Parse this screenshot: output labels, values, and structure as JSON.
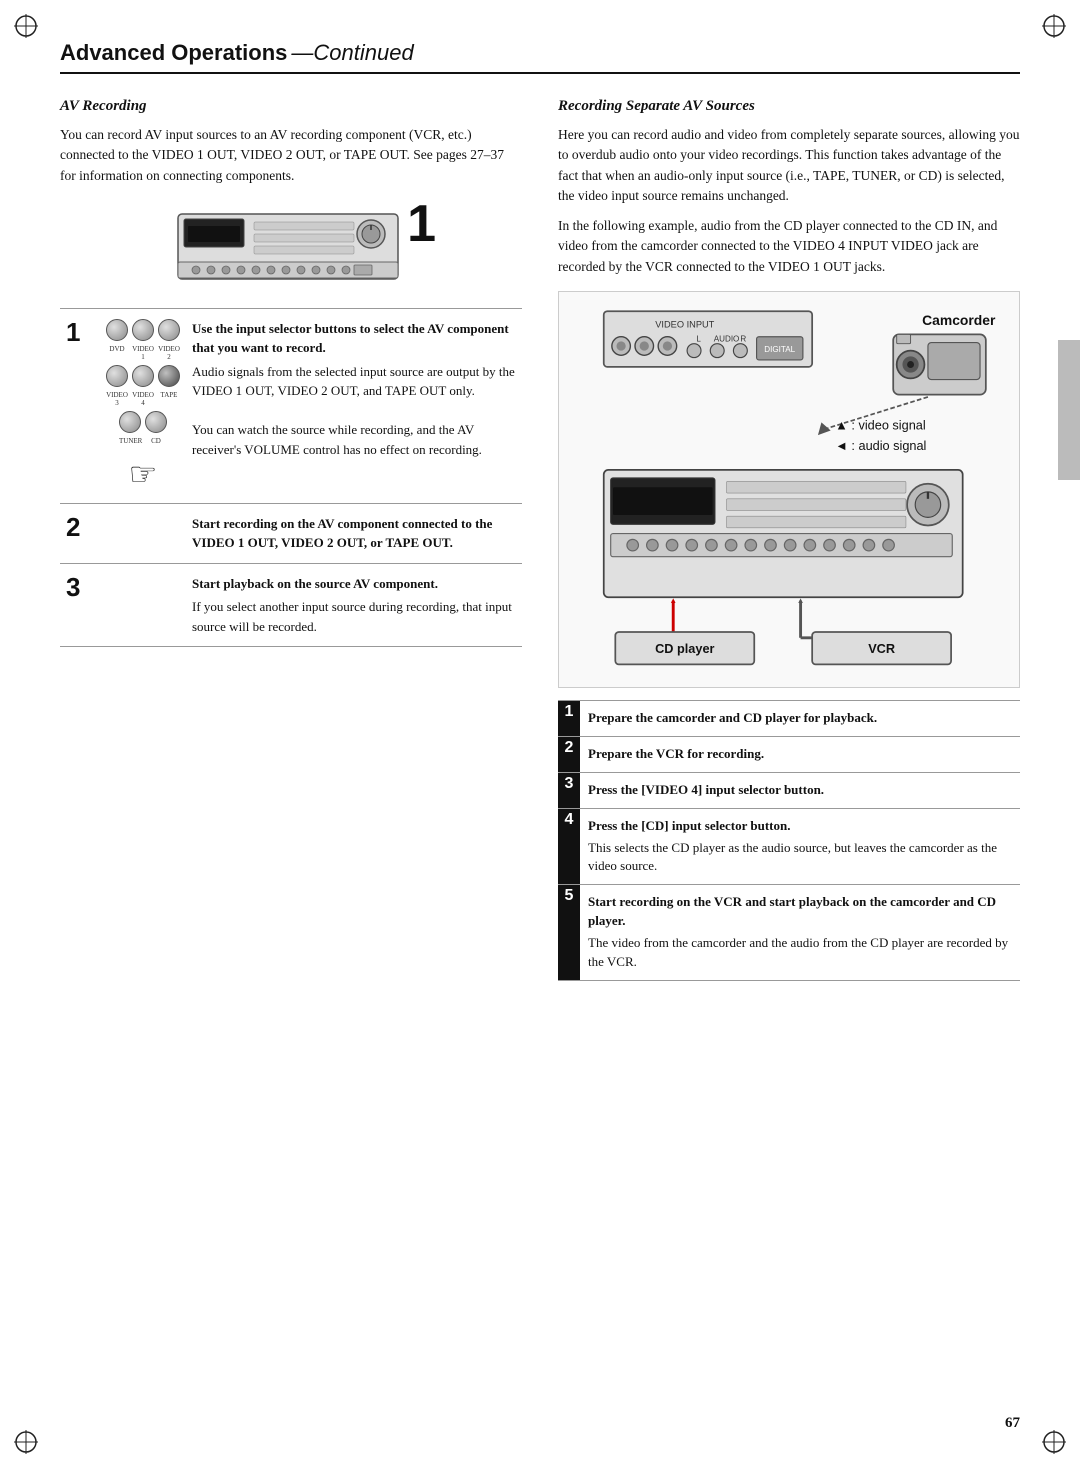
{
  "page": {
    "number": "67",
    "header": {
      "title": "Advanced Operations",
      "continued": "—Continued"
    },
    "gray_sidebar": true
  },
  "left_column": {
    "section_title": "AV Recording",
    "intro_text": "You can record AV input sources to an AV recording component (VCR, etc.) connected to the VIDEO 1 OUT, VIDEO 2 OUT, or TAPE OUT. See pages 27–37 for information on connecting components.",
    "steps": [
      {
        "num": "1",
        "title": "Use the input selector buttons to select the AV component that you want to record.",
        "body": "Audio signals from the selected input source are output by the VIDEO 1 OUT, VIDEO 2 OUT, and TAPE OUT only.\nYou can watch the source while recording, and the AV receiver's VOLUME control has no effect on recording.",
        "has_icon": true
      },
      {
        "num": "2",
        "title": "Start recording on the AV component connected to the VIDEO 1 OUT, VIDEO 2 OUT, or TAPE OUT.",
        "body": "",
        "has_icon": false
      },
      {
        "num": "3",
        "title": "Start playback on the source AV component.",
        "body": "If you select another input source during recording, that input source will be recorded.",
        "has_icon": false
      }
    ]
  },
  "right_column": {
    "section_title": "Recording Separate AV Sources",
    "intro_text1": "Here you can record audio and video from completely separate sources, allowing you to overdub audio onto your video recordings. This function takes advantage of the fact that when an audio-only input source (i.e., TAPE, TUNER, or CD) is selected, the video input source remains unchanged.",
    "intro_text2": "In the following example, audio from the CD player connected to the CD IN, and video from the camcorder connected to the VIDEO 4 INPUT VIDEO jack are recorded by the VCR connected to the VIDEO 1 OUT jacks.",
    "diagram": {
      "camcorder_label": "Camcorder",
      "video_signal_label": ": video signal",
      "audio_signal_label": ": audio signal",
      "cd_player_label": "CD player",
      "vcr_label": "VCR"
    },
    "steps": [
      {
        "num": "1",
        "title": "Prepare the camcorder and CD player for playback.",
        "body": ""
      },
      {
        "num": "2",
        "title": "Prepare the VCR for recording.",
        "body": ""
      },
      {
        "num": "3",
        "title": "Press the [VIDEO 4] input selector button.",
        "body": ""
      },
      {
        "num": "4",
        "title": "Press the [CD] input selector button.",
        "body": "This selects the CD player as the audio source, but leaves the camcorder as the video source."
      },
      {
        "num": "5",
        "title": "Start recording on the VCR and start playback on the camcorder and CD player.",
        "body": "The video from the camcorder and the audio from the CD player are recorded by the VCR."
      }
    ]
  }
}
